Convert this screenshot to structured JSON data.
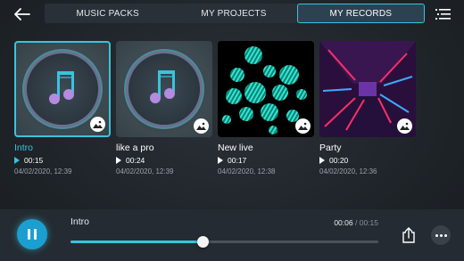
{
  "tabs": [
    {
      "label": "MUSIC PACKS",
      "active": false
    },
    {
      "label": "MY PROJECTS",
      "active": false
    },
    {
      "label": "MY RECORDS",
      "active": true
    }
  ],
  "records": [
    {
      "title": "Intro",
      "duration": "00:15",
      "date": "04/02/2020, 12:39",
      "artwork": "music-note",
      "selected": true
    },
    {
      "title": "like a pro",
      "duration": "00:24",
      "date": "04/02/2020, 12:39",
      "artwork": "music-note",
      "selected": false
    },
    {
      "title": "New live",
      "duration": "00:17",
      "date": "04/02/2020, 12:38",
      "artwork": "striped-spheres",
      "selected": false
    },
    {
      "title": "Party",
      "duration": "00:20",
      "date": "04/02/2020, 12:36",
      "artwork": "neon-tunnel",
      "selected": false
    }
  ],
  "player": {
    "track": "Intro",
    "elapsed": "00:06",
    "separator": "/",
    "total": "00:15",
    "progress": 0.43,
    "state": "playing"
  },
  "colors": {
    "accent": "#38c4dd",
    "play_button": "#1b9fd0"
  }
}
